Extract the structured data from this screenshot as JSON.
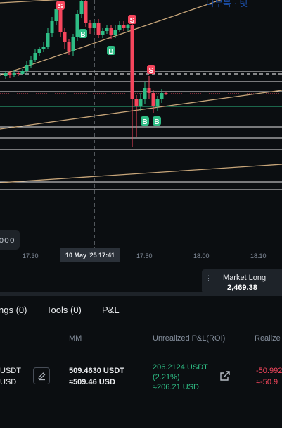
{
  "chart": {
    "watermark": "나무북 · 텃",
    "markers": {
      "sell": "S",
      "buy": "B"
    },
    "time_ticks": [
      "17:30",
      "17:50",
      "18:00",
      "18:10"
    ],
    "crosshair_time": "10 May '25   17:41",
    "more_label": "ooo",
    "colors": {
      "up": "#2ebd85",
      "down": "#f6465d",
      "trendline": "#c8a67a",
      "level": "#ffffff"
    }
  },
  "market_long": {
    "title": "Market Long",
    "value": "2,469.38"
  },
  "tabs": [
    {
      "label": "ngs (0)"
    },
    {
      "label": "Tools (0)"
    },
    {
      "label": "P&L"
    }
  ],
  "table": {
    "headers": {
      "mm": "MM",
      "unrealized": "Unrealized P&L(ROI)",
      "realized": "Realize"
    },
    "row": {
      "col0_line1": "USDT",
      "col0_line2": "USD",
      "mm_line1": "509.4630 USDT",
      "mm_line2": "≈509.46 USD",
      "pnl_line1": "206.2124 USDT",
      "pnl_line2": "(2.21%)",
      "pnl_line3": "≈206.21 USD",
      "realized_line1": "-50.992",
      "realized_line2": "≈-50.9"
    }
  }
}
